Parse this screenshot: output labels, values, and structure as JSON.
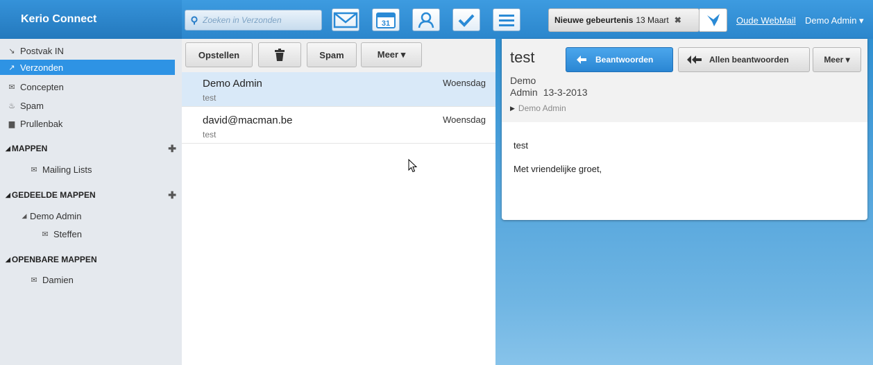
{
  "app": {
    "name": "Kerio Connect"
  },
  "search": {
    "placeholder": "Zoeken in Verzonden"
  },
  "apps": [
    {
      "name": "mail-icon"
    },
    {
      "name": "calendar-icon",
      "label": "31"
    },
    {
      "name": "contacts-icon"
    },
    {
      "name": "tasks-icon"
    },
    {
      "name": "notes-icon"
    }
  ],
  "event": {
    "title": "Nieuwe gebeurtenis",
    "date": "13 Maart",
    "close": "✖"
  },
  "header": {
    "old_webmail": "Oude WebMail",
    "user": "Demo Admin ▾"
  },
  "sidebar": {
    "folders": [
      {
        "label": "Postvak IN",
        "icon": "inbox-icon"
      },
      {
        "label": "Verzonden",
        "icon": "sent-icon"
      },
      {
        "label": "Concepten",
        "icon": "drafts-icon"
      },
      {
        "label": "Spam",
        "icon": "spam-icon"
      },
      {
        "label": "Prullenbak",
        "icon": "trash-icon"
      }
    ],
    "mappen": {
      "title": "MAPPEN",
      "items": [
        "Mailing Lists"
      ]
    },
    "gedeelde": {
      "title": "GEDEELDE MAPPEN",
      "owner": "Demo Admin",
      "items": [
        "Steffen"
      ]
    },
    "openbare": {
      "title": "OPENBARE MAPPEN",
      "items": [
        "Damien"
      ]
    }
  },
  "toolbar": {
    "compose": "Opstellen",
    "spam": "Spam",
    "more": "Meer ▾"
  },
  "messages": [
    {
      "from": "Demo Admin",
      "subject": "test",
      "date": "Woensdag"
    },
    {
      "from": "david@macman.be",
      "subject": "test",
      "date": "Woensdag"
    }
  ],
  "reader": {
    "subject": "test",
    "reply": "Beantwoorden",
    "reply_all": "Allen beantwoorden",
    "more": "Meer ▾",
    "sender_line1": "Demo",
    "sender_line2": "Admin",
    "date": "13-3-2013",
    "recipient": "Demo Admin",
    "body_line1": "test",
    "body_line2": "Met vriendelijke groet,"
  },
  "colors": {
    "accent": "#2e93e4",
    "topbar": "#3d9be0"
  }
}
